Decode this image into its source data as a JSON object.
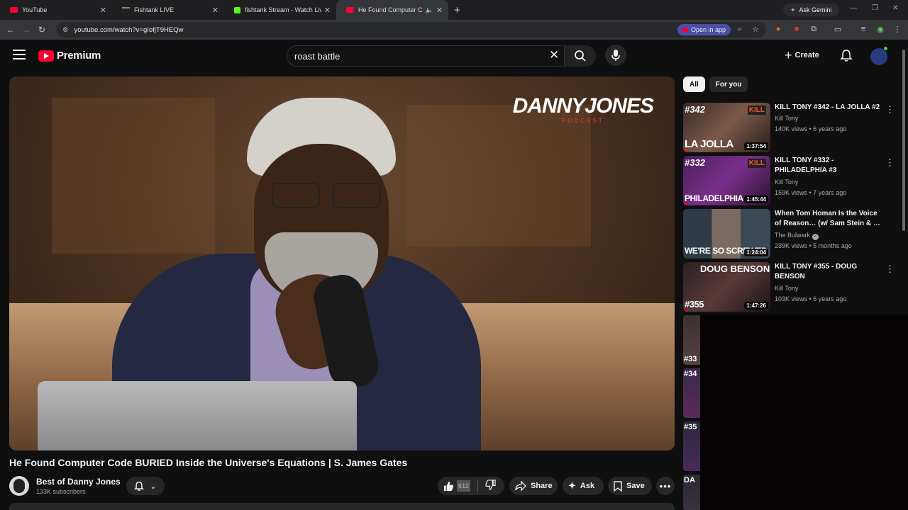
{
  "browser": {
    "tabs": [
      {
        "title": "YouTube",
        "active": false
      },
      {
        "title": "Fishtank LIVE",
        "active": false
      },
      {
        "title": "fishtank Stream - Watch Live on",
        "active": false
      },
      {
        "title": "He Found Computer Code",
        "active": true
      }
    ],
    "ask_gemini": "Ask Gemini",
    "url": "youtube.com/watch?v=gIofjT9HEQw",
    "open_in_app": "Open in app"
  },
  "header": {
    "logo_text": "Premium",
    "search_value": "roast battle",
    "create_label": "Create"
  },
  "player": {
    "brand_title": "DANNYJONES",
    "brand_sub": "PODCAST"
  },
  "video": {
    "title": "He Found Computer Code BURIED Inside the Universe's Equations | S. James Gates",
    "channel": "Best of Danny Jones",
    "subscribers": "133K subscribers",
    "like_count": "612",
    "share_label": "Share",
    "ask_label": "Ask",
    "save_label": "Save"
  },
  "sidebar": {
    "chips": [
      "All",
      "For you"
    ],
    "recommendations": [
      {
        "title": "KILL TONY #342 - LA JOLLA #2",
        "channel": "Kill Tony",
        "meta": "140K views • 6 years ago",
        "duration": "1:37:54",
        "thumb_tag": "#342",
        "thumb_caption": "LA JOLLA",
        "verified": false,
        "watched": 0.05
      },
      {
        "title": "KILL TONY #332 - PHILADELPHIA #3",
        "channel": "Kill Tony",
        "meta": "159K views • 7 years ago",
        "duration": "1:45:44",
        "thumb_tag": "#332",
        "thumb_caption": "PHILADELPHIA",
        "verified": false,
        "watched": 0.05
      },
      {
        "title": "When Tom Homan Is the Voice of Reason… (w/ Sam Stein & …",
        "channel": "The Bulwark",
        "meta": "239K views • 5 months ago",
        "duration": "1:24:04",
        "thumb_tag": "",
        "thumb_caption": "WE'RE SO SCREWED",
        "verified": true,
        "watched": 0
      },
      {
        "title": "KILL TONY #355 - DOUG BENSON",
        "channel": "Kill Tony",
        "meta": "103K views • 6 years ago",
        "duration": "1:47:26",
        "thumb_tag": "#355",
        "thumb_caption": "DOUG BENSON",
        "verified": false,
        "watched": 0.05
      }
    ],
    "partial_tags": [
      "#33",
      "#34",
      "#35",
      "DA"
    ]
  }
}
